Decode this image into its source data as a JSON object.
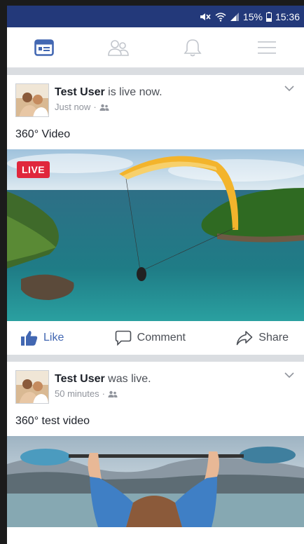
{
  "status_bar": {
    "battery": "15%",
    "time": "15:36"
  },
  "nav": {
    "tabs": [
      {
        "name": "news-feed",
        "icon": "news-feed-icon",
        "active": true
      },
      {
        "name": "friends",
        "icon": "friends-icon",
        "active": false
      },
      {
        "name": "notifications",
        "icon": "bell-icon",
        "active": false
      },
      {
        "name": "menu",
        "icon": "hamburger-icon",
        "active": false
      }
    ]
  },
  "posts": [
    {
      "author": "Test User",
      "action": " is live now.",
      "time": "Just now",
      "privacy_icon": "friends-icon",
      "text": "360° Video",
      "badge": "LIVE",
      "actions": {
        "like": "Like",
        "comment": "Comment",
        "share": "Share"
      }
    },
    {
      "author": "Test User",
      "action": " was live.",
      "time": "50 minutes",
      "privacy_icon": "friends-icon",
      "text": "360° test video"
    }
  ],
  "colors": {
    "status_bar": "#23397a",
    "brand": "#4267b2",
    "live": "#e0273c",
    "separator": "#dadde1"
  }
}
